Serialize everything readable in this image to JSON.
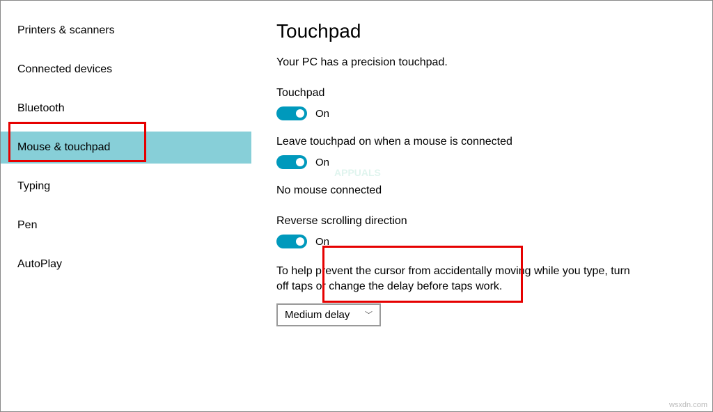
{
  "sidebar": {
    "items": [
      {
        "label": "Printers & scanners",
        "selected": false
      },
      {
        "label": "Connected devices",
        "selected": false
      },
      {
        "label": "Bluetooth",
        "selected": false
      },
      {
        "label": "Mouse & touchpad",
        "selected": true
      },
      {
        "label": "Typing",
        "selected": false
      },
      {
        "label": "Pen",
        "selected": false
      },
      {
        "label": "AutoPlay",
        "selected": false
      }
    ]
  },
  "main": {
    "title": "Touchpad",
    "description": "Your PC has a precision touchpad.",
    "touchpad_label": "Touchpad",
    "touchpad_state": "On",
    "leave_on_label": "Leave touchpad on when a mouse is connected",
    "leave_on_state": "On",
    "mouse_status": "No mouse connected",
    "reverse_label": "Reverse scrolling direction",
    "reverse_state": "On",
    "help_text": "To help prevent the cursor from accidentally moving while you type, turn off taps or change the delay before taps work.",
    "delay_value": "Medium delay"
  },
  "watermark": "APPUALS",
  "attribution": "wsxdn.com"
}
